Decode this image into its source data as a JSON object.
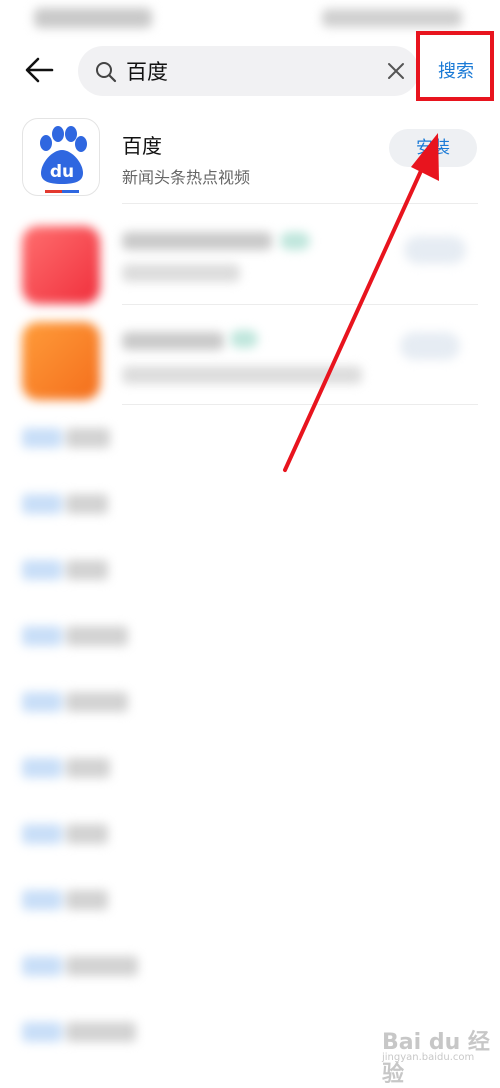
{
  "search": {
    "query": "百度",
    "button_label": "搜索"
  },
  "results": [
    {
      "name": "百度",
      "description": "新闻头条热点视频",
      "action": "安装"
    }
  ],
  "watermark": {
    "text": "Bai du 经验",
    "sub": "jingyan.baidu.com"
  },
  "colors": {
    "accent": "#1a7ad6",
    "annotation": "#e8141e"
  }
}
